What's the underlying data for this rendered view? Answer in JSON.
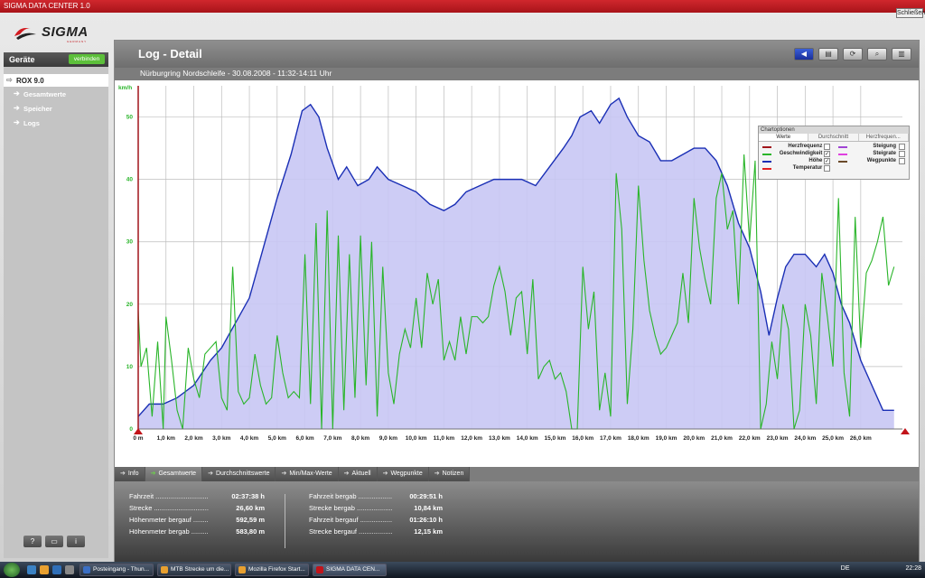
{
  "window": {
    "title": "SIGMA DATA CENTER 1.0",
    "close_label": "Schließen"
  },
  "logo": {
    "brand": "SIGMA",
    "sub": "GERMANY"
  },
  "sidebar": {
    "header": "Geräte",
    "connect_label": "verbinden",
    "device": "ROX 9.0",
    "items": [
      {
        "label": "Gesamtwerte"
      },
      {
        "label": "Speicher"
      },
      {
        "label": "Logs"
      }
    ],
    "bottom_buttons": [
      "?",
      "▭",
      "i"
    ]
  },
  "main": {
    "title": "Log - Detail",
    "subtitle": "Nürburgring Nordschleife - 30.08.2008 - 11:32-14:11 Uhr",
    "toolbar": [
      "back-icon",
      "print-icon",
      "refresh-icon",
      "zoom-icon",
      "export-icon"
    ]
  },
  "chart_options": {
    "title": "Chartoptionen",
    "tabs": [
      "Werte",
      "Durchschnitt",
      "Herzfrequen..."
    ],
    "left": [
      {
        "label": "Herzfrequenz",
        "color": "#a0141a",
        "checked": false
      },
      {
        "label": "Geschwindigkeit",
        "color": "#2ab52a",
        "checked": true
      },
      {
        "label": "Höhe",
        "color": "#1a2fb5",
        "checked": true
      },
      {
        "label": "Temperatur",
        "color": "#e02020",
        "checked": false
      }
    ],
    "right": [
      {
        "label": "Steigung",
        "color": "#a044d4",
        "checked": false
      },
      {
        "label": "Steigrate",
        "color": "#e040e0",
        "checked": false
      },
      {
        "label": "Wegpunkte",
        "color": "#6a4a2a",
        "checked": false
      }
    ]
  },
  "chart_data": {
    "type": "line",
    "ylabel": "km/h",
    "xlabel": "",
    "xlim": [
      0,
      27.5
    ],
    "ylim": [
      0,
      55
    ],
    "grid": true,
    "x_ticks": [
      "0 m",
      "1,0 km",
      "2,0 km",
      "3,0 km",
      "4,0 km",
      "5,0 km",
      "6,0 km",
      "7,0 km",
      "8,0 km",
      "9,0 km",
      "10,0 km",
      "11,0 km",
      "12,0 km",
      "13,0 km",
      "14,0 km",
      "15,0 km",
      "16,0 km",
      "17,0 km",
      "18,0 km",
      "19,0 km",
      "20,0 km",
      "21,0 km",
      "22,0 km",
      "23,0 km",
      "24,0 km",
      "25,0 km",
      "26,0 km"
    ],
    "y_ticks": [
      0,
      10,
      20,
      30,
      40,
      50
    ],
    "series": [
      {
        "name": "Höhe",
        "kind": "area",
        "line_color": "#1a2fb5",
        "fill_color": "#c8c6f4",
        "x": [
          0,
          0.4,
          0.9,
          1.4,
          2.0,
          2.6,
          3.0,
          3.5,
          4.0,
          4.5,
          5.0,
          5.5,
          5.9,
          6.2,
          6.5,
          6.8,
          7.2,
          7.5,
          7.9,
          8.3,
          8.6,
          9.0,
          9.5,
          10.0,
          10.5,
          11.0,
          11.4,
          11.8,
          12.3,
          12.8,
          13.3,
          13.8,
          14.3,
          14.8,
          15.3,
          15.6,
          15.9,
          16.3,
          16.6,
          17.0,
          17.3,
          17.6,
          18.0,
          18.4,
          18.8,
          19.2,
          19.6,
          20.0,
          20.4,
          20.8,
          21.2,
          21.6,
          22.0,
          22.4,
          22.7,
          23.0,
          23.3,
          23.6,
          24.0,
          24.4,
          24.7,
          25.0,
          25.3,
          25.6,
          26.0,
          26.4,
          26.8,
          27.2
        ],
        "values": [
          2,
          4,
          4,
          5,
          7,
          11,
          13,
          17,
          21,
          29,
          37,
          44,
          51,
          52,
          50,
          45,
          40,
          42,
          39,
          40,
          42,
          40,
          39,
          38,
          36,
          35,
          36,
          38,
          39,
          40,
          40,
          40,
          39,
          42,
          45,
          47,
          50,
          51,
          49,
          52,
          53,
          50,
          47,
          46,
          43,
          43,
          44,
          45,
          45,
          43,
          39,
          33,
          29,
          22,
          15,
          21,
          26,
          28,
          28,
          26,
          28,
          25,
          20,
          17,
          11,
          7,
          3,
          3
        ]
      },
      {
        "name": "Geschwindigkeit",
        "kind": "line",
        "line_color": "#2ab52a",
        "x": [
          0,
          0.1,
          0.3,
          0.5,
          0.7,
          0.9,
          1.0,
          1.2,
          1.4,
          1.6,
          1.8,
          2.0,
          2.2,
          2.4,
          2.6,
          2.8,
          3.0,
          3.2,
          3.4,
          3.6,
          3.8,
          4.0,
          4.2,
          4.4,
          4.6,
          4.8,
          5.0,
          5.2,
          5.4,
          5.6,
          5.8,
          6.0,
          6.2,
          6.4,
          6.6,
          6.8,
          7.0,
          7.2,
          7.4,
          7.6,
          7.8,
          8.0,
          8.2,
          8.4,
          8.6,
          8.8,
          9.0,
          9.2,
          9.4,
          9.6,
          9.8,
          10.0,
          10.2,
          10.4,
          10.6,
          10.8,
          11.0,
          11.2,
          11.4,
          11.6,
          11.8,
          12.0,
          12.2,
          12.4,
          12.6,
          12.8,
          13.0,
          13.2,
          13.4,
          13.6,
          13.8,
          14.0,
          14.2,
          14.4,
          14.6,
          14.8,
          15.0,
          15.2,
          15.4,
          15.6,
          15.8,
          16.0,
          16.2,
          16.4,
          16.6,
          16.8,
          17.0,
          17.2,
          17.4,
          17.6,
          17.8,
          18.0,
          18.2,
          18.4,
          18.6,
          18.8,
          19.0,
          19.2,
          19.4,
          19.6,
          19.8,
          20.0,
          20.2,
          20.4,
          20.6,
          20.8,
          21.0,
          21.2,
          21.4,
          21.6,
          21.8,
          22.0,
          22.2,
          22.4,
          22.6,
          22.8,
          23.0,
          23.2,
          23.4,
          23.6,
          23.8,
          24.0,
          24.2,
          24.4,
          24.6,
          24.8,
          25.0,
          25.2,
          25.4,
          25.6,
          25.8,
          26.0,
          26.2,
          26.4,
          26.6,
          26.8,
          27.0,
          27.2
        ],
        "values": [
          19,
          10,
          13,
          2,
          14,
          0,
          18,
          11,
          3,
          0,
          13,
          8,
          5,
          12,
          13,
          14,
          5,
          3,
          26,
          6,
          4,
          5,
          12,
          7,
          4,
          5,
          15,
          9,
          5,
          6,
          5,
          28,
          4,
          33,
          0,
          35,
          0,
          31,
          3,
          28,
          5,
          31,
          7,
          30,
          2,
          26,
          9,
          4,
          12,
          16,
          13,
          21,
          13,
          25,
          20,
          24,
          11,
          14,
          11,
          18,
          12,
          18,
          18,
          17,
          18,
          23,
          26,
          22,
          15,
          21,
          22,
          12,
          24,
          8,
          10,
          11,
          8,
          9,
          6,
          0,
          0,
          26,
          16,
          22,
          3,
          9,
          2,
          41,
          32,
          4,
          16,
          39,
          27,
          19,
          15,
          12,
          13,
          15,
          17,
          25,
          17,
          37,
          29,
          24,
          20,
          37,
          41,
          32,
          35,
          20,
          44,
          30,
          43,
          0,
          4,
          14,
          8,
          20,
          16,
          0,
          3,
          20,
          15,
          4,
          25,
          18,
          10,
          37,
          9,
          2,
          34,
          13,
          25,
          27,
          30,
          34,
          23,
          26
        ]
      }
    ]
  },
  "tabs": [
    {
      "label": "Info",
      "active": false
    },
    {
      "label": "Gesamtwerte",
      "active": true
    },
    {
      "label": "Durchschnittswerte",
      "active": false
    },
    {
      "label": "Min/Max-Werte",
      "active": false
    },
    {
      "label": "Aktuell",
      "active": false
    },
    {
      "label": "Wegpunkte",
      "active": false
    },
    {
      "label": "Notizen",
      "active": false
    }
  ],
  "stats": {
    "left": [
      {
        "label": "Fahrzeit ............................",
        "value": "02:37:38 h"
      },
      {
        "label": "Strecke .............................",
        "value": "26,60 km"
      },
      {
        "label": "Höhenmeter bergauf ........",
        "value": "592,59 m"
      },
      {
        "label": "Höhenmeter bergab .........",
        "value": "583,80 m"
      }
    ],
    "right": [
      {
        "label": "Fahrzeit bergab ..................",
        "value": "00:29:51 h"
      },
      {
        "label": "Strecke bergab ...................",
        "value": "10,84 km"
      },
      {
        "label": "Fahrzeit bergauf .................",
        "value": "01:26:10 h"
      },
      {
        "label": "Strecke bergauf ..................",
        "value": "12,15 km"
      }
    ]
  },
  "taskbar": {
    "tasks": [
      {
        "label": "Posteingang - Thun...",
        "active": false
      },
      {
        "label": "MTB Strecke um die...",
        "active": false
      },
      {
        "label": "Mozilla Firefox Start...",
        "active": false
      },
      {
        "label": "SIGMA DATA CEN...",
        "active": true
      }
    ],
    "language": "DE",
    "clock": "22:28"
  }
}
